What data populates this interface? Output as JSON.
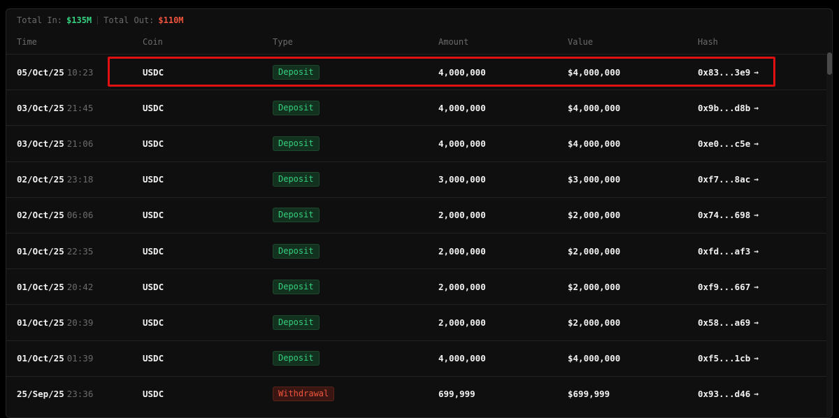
{
  "summary": {
    "total_in_label": "Total In:",
    "total_in_value": "$135M",
    "total_out_label": "Total Out:",
    "total_out_value": "$110M"
  },
  "columns": {
    "time": "Time",
    "coin": "Coin",
    "type": "Type",
    "amount": "Amount",
    "value": "Value",
    "hash": "Hash"
  },
  "colors": {
    "deposit": "#35d07f",
    "withdrawal": "#f0543c",
    "highlight": "#e01010"
  },
  "rows": [
    {
      "date": "05/Oct/25",
      "time": "10:23",
      "coin": "USDC",
      "type": "Deposit",
      "amount": "4,000,000",
      "value": "$4,000,000",
      "hash": "0x83...3e9",
      "arrow": "→"
    },
    {
      "date": "03/Oct/25",
      "time": "21:45",
      "coin": "USDC",
      "type": "Deposit",
      "amount": "4,000,000",
      "value": "$4,000,000",
      "hash": "0x9b...d8b",
      "arrow": "→"
    },
    {
      "date": "03/Oct/25",
      "time": "21:06",
      "coin": "USDC",
      "type": "Deposit",
      "amount": "4,000,000",
      "value": "$4,000,000",
      "hash": "0xe0...c5e",
      "arrow": "→"
    },
    {
      "date": "02/Oct/25",
      "time": "23:18",
      "coin": "USDC",
      "type": "Deposit",
      "amount": "3,000,000",
      "value": "$3,000,000",
      "hash": "0xf7...8ac",
      "arrow": "→"
    },
    {
      "date": "02/Oct/25",
      "time": "06:06",
      "coin": "USDC",
      "type": "Deposit",
      "amount": "2,000,000",
      "value": "$2,000,000",
      "hash": "0x74...698",
      "arrow": "→"
    },
    {
      "date": "01/Oct/25",
      "time": "22:35",
      "coin": "USDC",
      "type": "Deposit",
      "amount": "2,000,000",
      "value": "$2,000,000",
      "hash": "0xfd...af3",
      "arrow": "→"
    },
    {
      "date": "01/Oct/25",
      "time": "20:42",
      "coin": "USDC",
      "type": "Deposit",
      "amount": "2,000,000",
      "value": "$2,000,000",
      "hash": "0xf9...667",
      "arrow": "→"
    },
    {
      "date": "01/Oct/25",
      "time": "20:39",
      "coin": "USDC",
      "type": "Deposit",
      "amount": "2,000,000",
      "value": "$2,000,000",
      "hash": "0x58...a69",
      "arrow": "→"
    },
    {
      "date": "01/Oct/25",
      "time": "01:39",
      "coin": "USDC",
      "type": "Deposit",
      "amount": "4,000,000",
      "value": "$4,000,000",
      "hash": "0xf5...1cb",
      "arrow": "→"
    },
    {
      "date": "25/Sep/25",
      "time": "23:36",
      "coin": "USDC",
      "type": "Withdrawal",
      "amount": "699,999",
      "value": "$699,999",
      "hash": "0x93...d46",
      "arrow": "→"
    }
  ]
}
